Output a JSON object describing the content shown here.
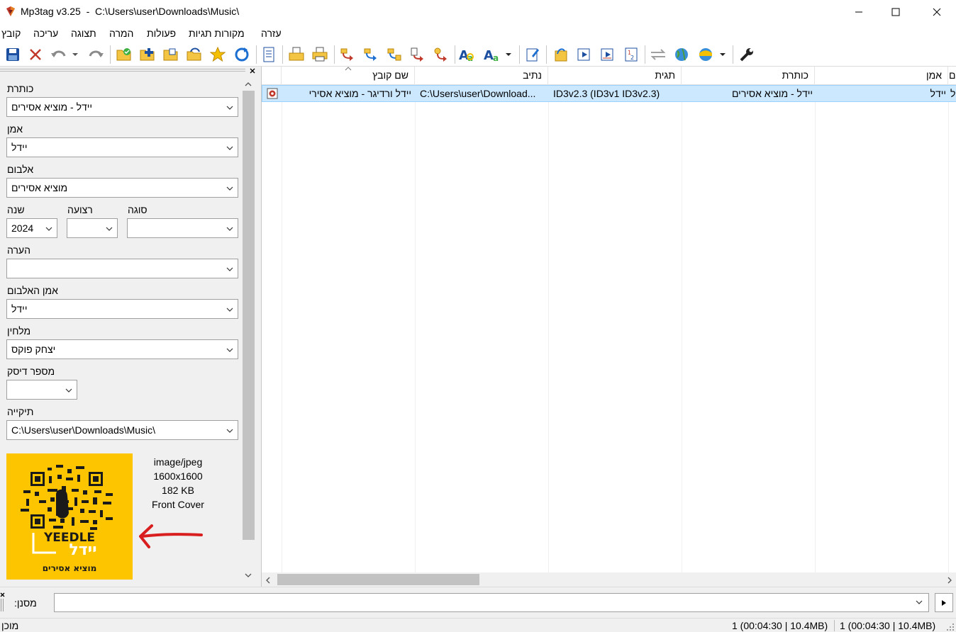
{
  "window": {
    "title": "Mp3tag v3.25  -  C:\\Users\\user\\Downloads\\Music\\"
  },
  "menu": {
    "items": [
      "קובץ",
      "עריכה",
      "תצוגה",
      "המרה",
      "פעולות",
      "מקורות תגיות",
      "עזרה"
    ]
  },
  "toolbar": {
    "icons": [
      "save-icon",
      "remove-tag-icon",
      "undo-icon",
      "undo-dropdown-icon",
      "redo-icon",
      "change-directory-icon",
      "add-directory-icon",
      "open-folder-icon",
      "refresh-folder-icon",
      "favorites-icon",
      "reload-icon",
      "extended-tags-icon",
      "export-icon",
      "print-icon",
      "tag-filename-icon",
      "filename-tag-icon",
      "filename-filename-icon",
      "text-file-tag-icon",
      "tag-tag-icon",
      "case-conversion-icon",
      "auto-numbering-icon",
      "edit-icon",
      "playlist-icon",
      "actions-icon",
      "quick-action-icon",
      "numbering-icon",
      "convert-icon",
      "web-source-icon",
      "tag-sources-icon",
      "tag-sources-dropdown-icon",
      "options-icon"
    ]
  },
  "tagpanel": {
    "fields": {
      "title": {
        "label": "כותרת",
        "value": "יידל - מוציא אסירים"
      },
      "artist": {
        "label": "אמן",
        "value": "יידל"
      },
      "album": {
        "label": "אלבום",
        "value": "מוציא אסירים"
      },
      "year": {
        "label": "שנה",
        "value": "2024"
      },
      "track": {
        "label": "רצועה",
        "value": ""
      },
      "genre": {
        "label": "סוגה",
        "value": ""
      },
      "comment": {
        "label": "הערה",
        "value": ""
      },
      "album_artist": {
        "label": "אמן האלבום",
        "value": "יידל"
      },
      "composer": {
        "label": "מלחין",
        "value": "יצחק פוקס"
      },
      "disc": {
        "label": "מספר דיסק",
        "value": ""
      },
      "directory": {
        "label": "תיקייה",
        "value": "C:\\Users\\user\\Downloads\\Music\\"
      }
    },
    "cover": {
      "mime": "image/jpeg",
      "dimensions": "1600x1600",
      "size": "182 KB",
      "type": "Front Cover",
      "logo_text": "YEEDLE",
      "logo_hebrew": "יידל",
      "logo_subtitle": "מוציא אסירים",
      "background": "#fdc500"
    }
  },
  "filelist": {
    "columns": [
      "שם קובץ",
      "נתיב",
      "תגית",
      "כותרת",
      "אמן",
      "ם"
    ],
    "rows": [
      {
        "filename": "יידל ורדיגר - מוציא אסירי",
        "path": "C:\\Users\\user\\Download...",
        "tag": "ID3v2.3 (ID3v1 ID3v2.3)",
        "title": "יידל - מוציא אסירים",
        "artist": "יידל",
        "extra": "ל"
      }
    ],
    "selected_color": "#cce8ff"
  },
  "filter": {
    "label": ":מסנן",
    "value": ""
  },
  "status": {
    "left": "מוכן",
    "selected": "1 (00:04:30 | 10.4MB)",
    "total": "1 (00:04:30 | 10.4MB)"
  }
}
